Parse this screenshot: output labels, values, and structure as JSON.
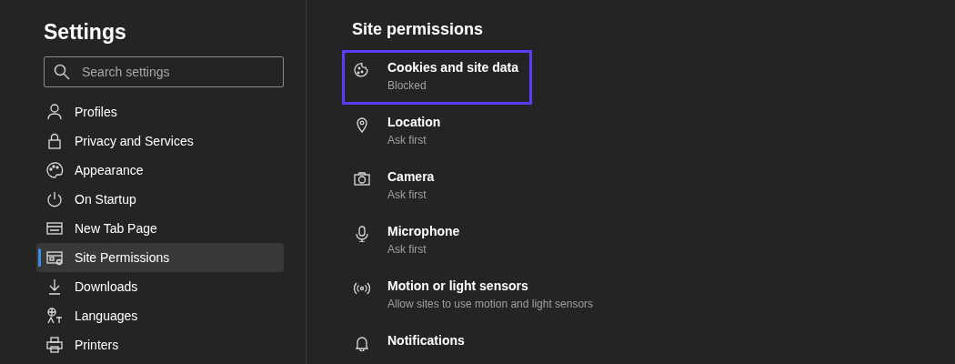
{
  "sidebar": {
    "title": "Settings",
    "search": {
      "placeholder": "Search settings"
    },
    "items": [
      {
        "label": "Profiles",
        "selected": false
      },
      {
        "label": "Privacy and Services",
        "selected": false
      },
      {
        "label": "Appearance",
        "selected": false
      },
      {
        "label": "On Startup",
        "selected": false
      },
      {
        "label": "New Tab Page",
        "selected": false
      },
      {
        "label": "Site Permissions",
        "selected": true
      },
      {
        "label": "Downloads",
        "selected": false
      },
      {
        "label": "Languages",
        "selected": false
      },
      {
        "label": "Printers",
        "selected": false
      }
    ]
  },
  "content": {
    "title": "Site permissions",
    "permissions": [
      {
        "name": "Cookies and site data",
        "status": "Blocked",
        "highlighted": true
      },
      {
        "name": "Location",
        "status": "Ask first",
        "highlighted": false
      },
      {
        "name": "Camera",
        "status": "Ask first",
        "highlighted": false
      },
      {
        "name": "Microphone",
        "status": "Ask first",
        "highlighted": false
      },
      {
        "name": "Motion or light sensors",
        "status": "Allow sites to use motion and light sensors",
        "highlighted": false
      },
      {
        "name": "Notifications",
        "highlighted": false
      }
    ]
  }
}
